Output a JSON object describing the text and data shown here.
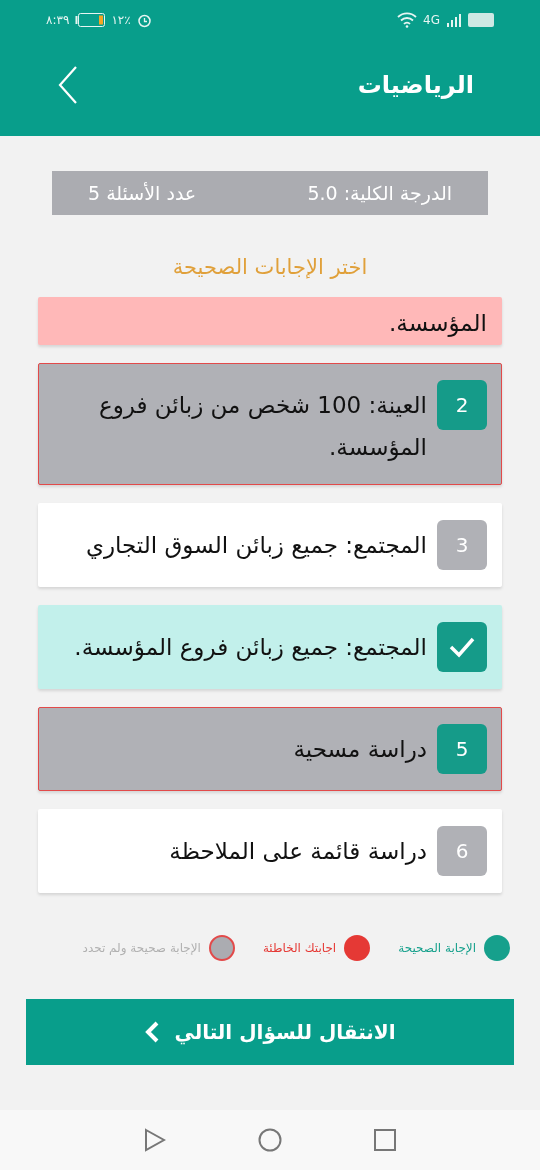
{
  "status_bar": {
    "time": "٨:٣٩",
    "battery": "١٢٪",
    "network": "4G"
  },
  "header": {
    "title": "الرياضيات"
  },
  "summary": {
    "total_score": "الدرجة الكلية: 5.0",
    "question_count": "عدد الأسئلة 5"
  },
  "instruction": "اختر الإجابات الصحيحة",
  "options": [
    {
      "kind": "wrong",
      "text": "المؤسسة."
    },
    {
      "kind": "missed",
      "number": "2",
      "text": "العينة: 100 شخص من زبائن فروع المؤسسة."
    },
    {
      "kind": "plain",
      "number": "3",
      "text": "المجتمع: جميع زبائن السوق التجاري"
    },
    {
      "kind": "correct",
      "text": "المجتمع: جميع زبائن فروع المؤسسة."
    },
    {
      "kind": "missed",
      "number": "5",
      "text": "دراسة مسحية"
    },
    {
      "kind": "plain",
      "number": "6",
      "text": "دراسة قائمة على الملاحظة"
    }
  ],
  "legend": [
    {
      "label": "الإجابة الصحيحة",
      "color": "#16a08c"
    },
    {
      "label": "اجابتك الخاطئة",
      "color": "#e53935"
    },
    {
      "label": "الإجابة صحيحة ولم تحدد",
      "color": "#abacb1"
    }
  ],
  "next_button": "الانتقال للسؤال التالي"
}
